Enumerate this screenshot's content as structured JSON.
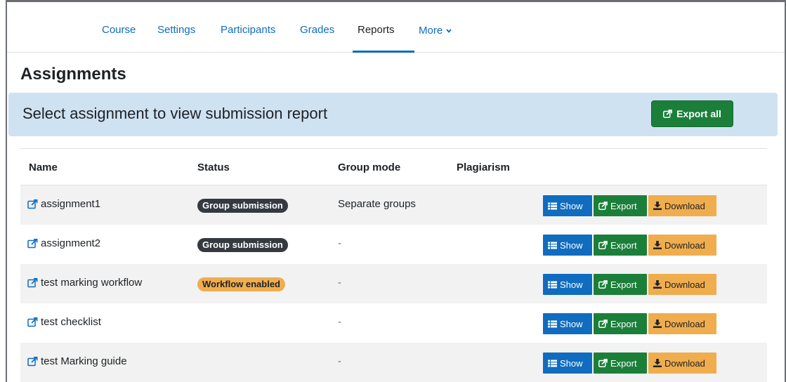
{
  "nav": {
    "items": [
      {
        "label": "Course"
      },
      {
        "label": "Settings"
      },
      {
        "label": "Participants"
      },
      {
        "label": "Grades"
      },
      {
        "label": "Reports"
      },
      {
        "label": "More"
      }
    ],
    "active": "Reports",
    "more_icon": "chevron-down-icon"
  },
  "page": {
    "title": "Assignments",
    "banner_text": "Select assignment to view submission report",
    "export_all_label": "Export all"
  },
  "table": {
    "headers": {
      "name": "Name",
      "status": "Status",
      "group_mode": "Group mode",
      "plagiarism": "Plagiarism"
    },
    "rows": [
      {
        "name": "assignment1",
        "status": "Group submission",
        "group_mode": "Separate groups"
      },
      {
        "name": "assignment2",
        "status": "Group submission",
        "group_mode": "-"
      },
      {
        "name": "test marking workflow",
        "status": "Workflow enabled",
        "group_mode": "-"
      },
      {
        "name": "test checklist",
        "status": "",
        "group_mode": "-"
      },
      {
        "name": "test Marking guide",
        "status": "",
        "group_mode": "-"
      }
    ],
    "actions": {
      "show": "Show",
      "export": "Export",
      "download": "Download"
    }
  },
  "colors": {
    "primary": "#0f6cbf",
    "success": "#1b7f3a",
    "warning": "#f0ad4e",
    "dark": "#343a40",
    "banner": "#cfe2f2"
  },
  "icons": {
    "link": "external-link-icon",
    "show": "list-icon",
    "export": "share-square-icon",
    "download": "download-icon"
  }
}
